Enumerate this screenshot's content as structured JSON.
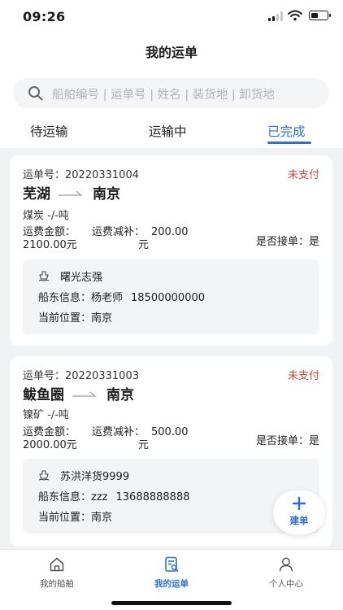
{
  "status_bar": {
    "time": "09:26"
  },
  "header": {
    "title": "我的运单"
  },
  "search": {
    "placeholder": "船舶编号 | 运单号 | 姓名 | 装货地 | 卸货地"
  },
  "tabs": [
    {
      "label": "待运输"
    },
    {
      "label": "运输中"
    },
    {
      "label": "已完成",
      "active": true
    }
  ],
  "orders": [
    {
      "waybill_label": "运单号：",
      "waybill_no": "20220331004",
      "payment_status": "未支付",
      "origin": "芜湖",
      "destination": "南京",
      "cargo": "煤炭 -/-吨",
      "fee_label": "运费金额：",
      "fee_value": "2100.00元",
      "subsidy_label": "运费减补：",
      "subsidy_value_int": "200.00",
      "subsidy_value_unit": "元",
      "accept": "是否接单：是",
      "ship_name": "曙光志强",
      "owner_label": "船东信息：",
      "owner_name": "杨老师",
      "owner_phone": "18500000000",
      "position": "当前位置：南京"
    },
    {
      "waybill_label": "运单号：",
      "waybill_no": "20220331003",
      "payment_status": "未支付",
      "origin": "鲅鱼圈",
      "destination": "南京",
      "cargo": "镍矿 -/-吨",
      "fee_label": "运费金额：",
      "fee_value": "2000.00元",
      "subsidy_label": "运费减补：",
      "subsidy_value_int": "500.00",
      "subsidy_value_unit": "元",
      "accept": "是否接单：是",
      "ship_name": "苏洪洋货9999",
      "owner_label": "船东信息：",
      "owner_name": "zzz",
      "owner_phone": "13688888888",
      "position": "当前位置：南京"
    }
  ],
  "fab": {
    "label": "建单"
  },
  "tabbar": [
    {
      "label": "我的船舶",
      "icon": "house-icon"
    },
    {
      "label": "我的运单",
      "icon": "waybill-icon",
      "active": true
    },
    {
      "label": "个人中心",
      "icon": "person-icon"
    }
  ],
  "colors": {
    "accent": "#2f6fd1",
    "unpaid": "#d9453b",
    "background": "#f1f2f4"
  }
}
